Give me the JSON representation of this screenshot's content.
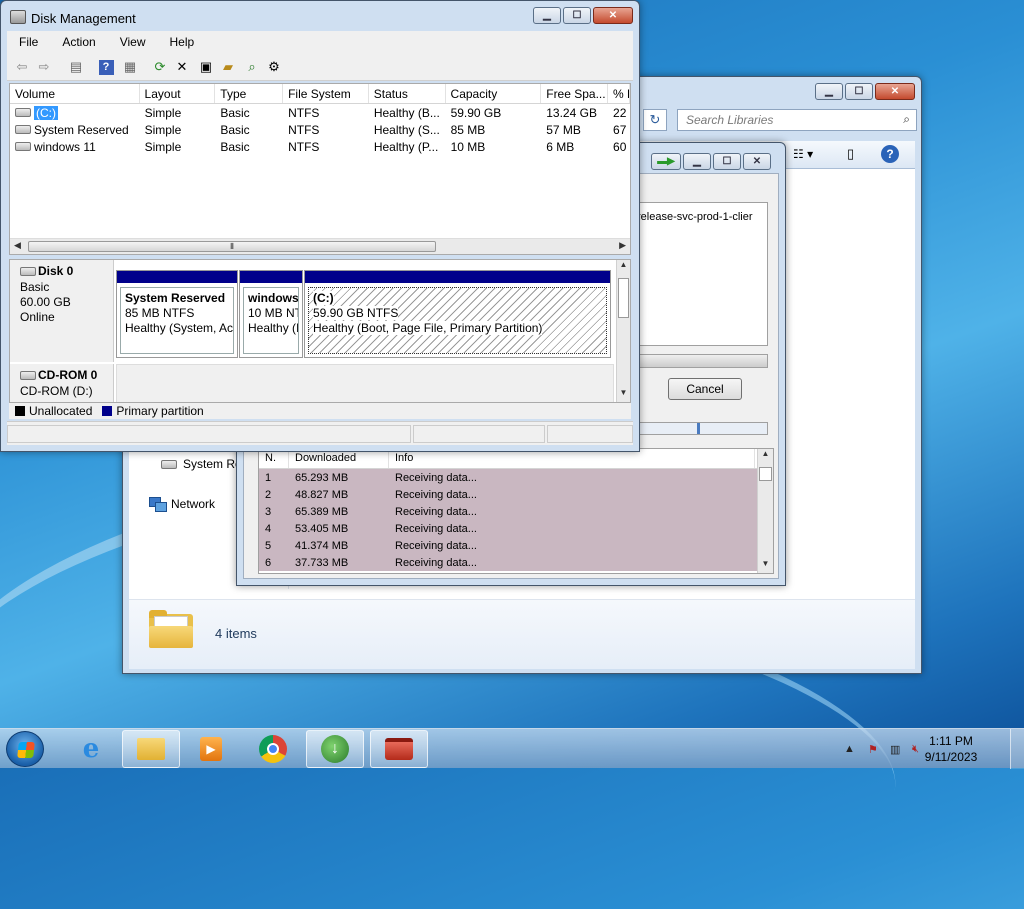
{
  "disk_management": {
    "title": "Disk Management",
    "menu": [
      "File",
      "Action",
      "View",
      "Help"
    ],
    "columns": [
      "Volume",
      "Layout",
      "Type",
      "File System",
      "Status",
      "Capacity",
      "Free Spa...",
      "% F"
    ],
    "volumes": [
      {
        "volume": "(C:)",
        "layout": "Simple",
        "type": "Basic",
        "fs": "NTFS",
        "status": "Healthy (B...",
        "capacity": "59.90 GB",
        "free": "13.24 GB",
        "pct": "22"
      },
      {
        "volume": "System Reserved",
        "layout": "Simple",
        "type": "Basic",
        "fs": "NTFS",
        "status": "Healthy (S...",
        "capacity": "85 MB",
        "free": "57 MB",
        "pct": "67"
      },
      {
        "volume": "windows 11",
        "layout": "Simple",
        "type": "Basic",
        "fs": "NTFS",
        "status": "Healthy (P...",
        "capacity": "10 MB",
        "free": "6 MB",
        "pct": "60"
      }
    ],
    "disk0": {
      "name": "Disk 0",
      "kind": "Basic",
      "size": "60.00 GB",
      "state": "Online"
    },
    "partitions": [
      {
        "name": "System Reserved",
        "size": "85 MB NTFS",
        "status": "Healthy (System, Ac"
      },
      {
        "name": "windows",
        "size": "10 MB NT",
        "status": "Healthy (I"
      },
      {
        "name": "(C:)",
        "size": "59.90 GB NTFS",
        "status": "Healthy (Boot, Page File, Primary Partition)"
      }
    ],
    "cdrom": {
      "name": "CD-ROM 0",
      "sub": "CD-ROM (D:)"
    },
    "legend": {
      "unallocated": "Unallocated",
      "primary": "Primary partition",
      "unallocated_color": "#000000",
      "primary_color": "#00008b"
    }
  },
  "explorer": {
    "search_placeholder": "Search Libraries",
    "nav_system": "System Re",
    "nav_network": "Network",
    "items_count": "4 items"
  },
  "download_dialog": {
    "url_text": "release-svc-prod-1-clier",
    "cancel_label": "Cancel",
    "columns": [
      "N.",
      "Downloaded",
      "Info"
    ],
    "rows": [
      {
        "n": "1",
        "downloaded": "65.293  MB",
        "info": "Receiving data..."
      },
      {
        "n": "2",
        "downloaded": "48.827  MB",
        "info": "Receiving data..."
      },
      {
        "n": "3",
        "downloaded": "65.389  MB",
        "info": "Receiving data..."
      },
      {
        "n": "4",
        "downloaded": "53.405  MB",
        "info": "Receiving data..."
      },
      {
        "n": "5",
        "downloaded": "41.374  MB",
        "info": "Receiving data..."
      },
      {
        "n": "6",
        "downloaded": "37.733  MB",
        "info": "Receiving data..."
      }
    ]
  },
  "taskbar": {
    "time": "1:11 PM",
    "date": "9/11/2023"
  }
}
